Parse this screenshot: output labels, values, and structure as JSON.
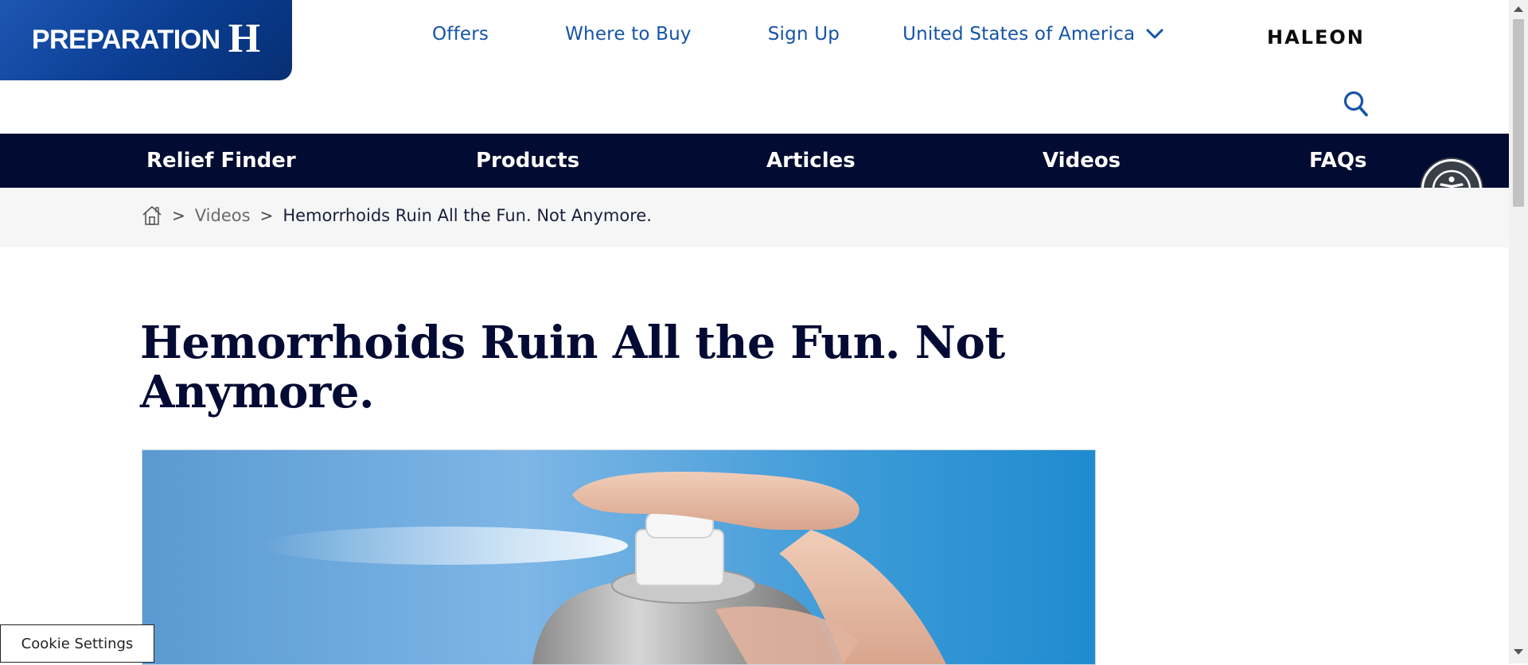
{
  "logo": {
    "word": "PREPARATION",
    "letter": "H"
  },
  "top_nav": {
    "offers": "Offers",
    "where_to_buy": "Where to Buy",
    "sign_up": "Sign Up",
    "country": "United States of America"
  },
  "brand": {
    "name": "HALEON"
  },
  "main_nav": {
    "relief_finder": "Relief Finder",
    "products": "Products",
    "articles": "Articles",
    "videos": "Videos",
    "faqs": "FAQs"
  },
  "breadcrumb": {
    "separator": ">",
    "videos": "Videos",
    "current": "Hemorrhoids Ruin All the Fun. Not Anymore."
  },
  "page": {
    "title": "Hemorrhoids Ruin All the Fun. Not Anymore."
  },
  "cookie": {
    "label": "Cookie Settings"
  },
  "colors": {
    "primary_blue": "#1554a8",
    "nav_dark": "#020b31",
    "logo_blue": "#0a3d91"
  }
}
